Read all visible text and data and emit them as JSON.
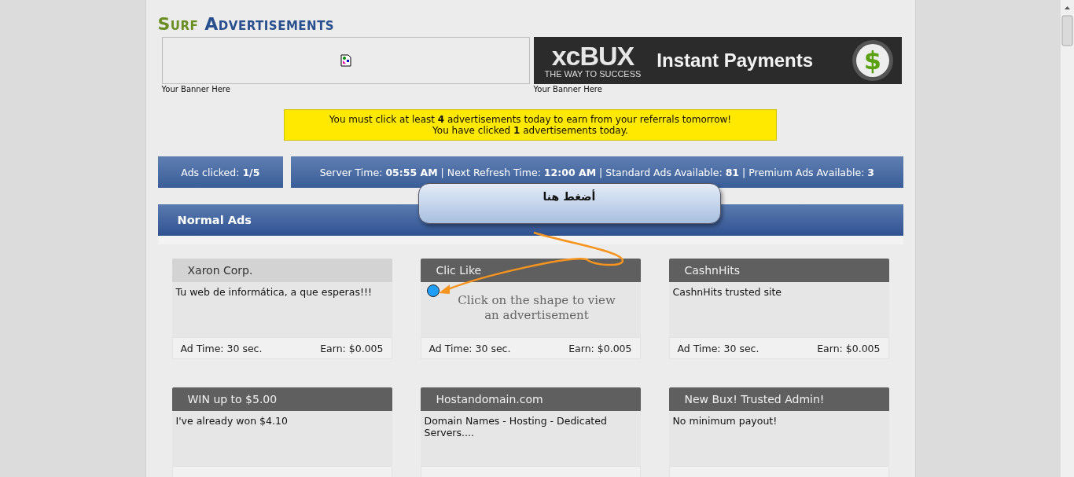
{
  "title": {
    "first": "Surf",
    "second": "Advertisements"
  },
  "banners": [
    {
      "kind": "broken",
      "caption": "Your Banner Here"
    },
    {
      "kind": "xcbux",
      "logo_main": "xcBUX",
      "logo_sub": "THE WAY TO SUCCESS",
      "slogan": "Instant Payments",
      "coin_symbol": "$",
      "caption": "Your Banner Here"
    }
  ],
  "notice": [
    "You must click at least **4** advertisements today to earn from your referrals tomorrow!",
    "You have clicked **1** advertisements today."
  ],
  "stats": {
    "clicked": "Ads clicked: **1/5**",
    "info": "Server Time: **05:55 AM** | Next Refresh Time: **12:00 AM** | Standard Ads Available: **81** | Premium Ads Available: **3**"
  },
  "section": "Normal Ads",
  "callout": "أضغط هنا",
  "ads": [
    {
      "title": "Xaron Corp.",
      "kind": "text",
      "text": "Tu web de informática, a que esperas!!!",
      "visited": true,
      "time": "Ad Time: 30 sec.",
      "earn": "Earn: $0.005"
    },
    {
      "title": "Clic Like",
      "kind": "shape",
      "text": "Click on the shape to view an advertisement",
      "visited": false,
      "time": "Ad Time: 30 sec.",
      "earn": "Earn: $0.005"
    },
    {
      "title": "CashnHits",
      "kind": "text",
      "text": "CashnHits trusted site",
      "visited": false,
      "time": "Ad Time: 30 sec.",
      "earn": "Earn: $0.005"
    },
    {
      "title": "WIN up to $5.00",
      "kind": "text",
      "text": "I've already won $4.10",
      "visited": false
    },
    {
      "title": "Hostandomain.com",
      "kind": "text",
      "text": "Domain Names - Hosting - Dedicated Servers....",
      "visited": false
    },
    {
      "title": "New Bux! Trusted Admin!",
      "kind": "text",
      "text": "No minimum payout!",
      "visited": false
    }
  ]
}
